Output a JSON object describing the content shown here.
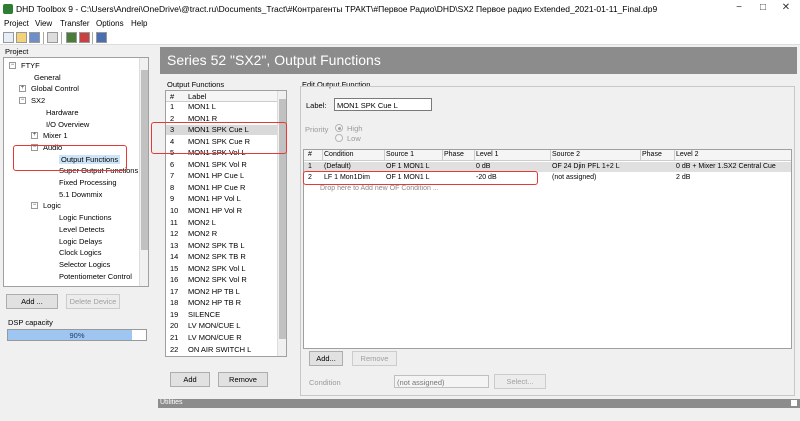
{
  "window": {
    "title": "DHD Toolbox 9 - C:\\Users\\Andrei\\OneDrive\\@tract.ru\\Documents_Tract\\#Контрагенты ТРАКТ\\#Первое Радио\\DHD\\SX2 Первое радио Extended_2021-01-11_Final.dp9"
  },
  "menu": [
    "Project",
    "View",
    "Transfer",
    "Options",
    "Help"
  ],
  "project": {
    "title": "Project",
    "tree": [
      {
        "label": "FTYF",
        "level": 0,
        "exp": "−"
      },
      {
        "label": "General",
        "level": 1
      },
      {
        "label": "Global Control",
        "level": 1,
        "exp": "+"
      },
      {
        "label": "SX2",
        "level": 1,
        "exp": "−"
      },
      {
        "label": "Hardware",
        "level": 2
      },
      {
        "label": "I/O Overview",
        "level": 2
      },
      {
        "label": "Mixer 1",
        "level": 2,
        "exp": "+"
      },
      {
        "label": "Audio",
        "level": 2,
        "exp": "−"
      },
      {
        "label": "Output Functions",
        "level": 3,
        "selected": true
      },
      {
        "label": "Super Output Functions",
        "level": 3
      },
      {
        "label": "Fixed Processing",
        "level": 3
      },
      {
        "label": "5.1 Downmix",
        "level": 3
      },
      {
        "label": "Logic",
        "level": 2,
        "exp": "−"
      },
      {
        "label": "Logic Functions",
        "level": 3
      },
      {
        "label": "Level Detects",
        "level": 3
      },
      {
        "label": "Logic Delays",
        "level": 3
      },
      {
        "label": "Clock Logics",
        "level": 3
      },
      {
        "label": "Selector Logics",
        "level": 3
      },
      {
        "label": "Potentiometer Control",
        "level": 3
      }
    ],
    "add": "Add ...",
    "delete": "Delete Device"
  },
  "dsp": {
    "title": "DSP capacity",
    "value": "90%",
    "fraction": 0.9
  },
  "header": "Series 52 \"SX2\", Output Functions",
  "of_list": {
    "title": "Output Functions",
    "col_num": "#",
    "col_label": "Label",
    "rows": [
      [
        "1",
        "MON1 L"
      ],
      [
        "2",
        "MON1 R"
      ],
      [
        "3",
        "MON1 SPK Cue L"
      ],
      [
        "4",
        "MON1 SPK Cue R"
      ],
      [
        "5",
        "MON1 SPK Vol L"
      ],
      [
        "6",
        "MON1 SPK Vol R"
      ],
      [
        "7",
        "MON1 HP Cue L"
      ],
      [
        "8",
        "MON1 HP Cue R"
      ],
      [
        "9",
        "MON1 HP Vol L"
      ],
      [
        "10",
        "MON1 HP Vol R"
      ],
      [
        "11",
        "MON2 L"
      ],
      [
        "12",
        "MON2 R"
      ],
      [
        "13",
        "MON2 SPK TB L"
      ],
      [
        "14",
        "MON2 SPK TB R"
      ],
      [
        "15",
        "MON2 SPK Vol L"
      ],
      [
        "16",
        "MON2 SPK Vol R"
      ],
      [
        "17",
        "MON2 HP TB L"
      ],
      [
        "18",
        "MON2 HP TB R"
      ],
      [
        "19",
        "SILENCE"
      ],
      [
        "20",
        "LV MON/CUE L"
      ],
      [
        "21",
        "LV MON/CUE R"
      ],
      [
        "22",
        "ON AIR SWITCH L"
      ]
    ],
    "add": "Add",
    "remove": "Remove"
  },
  "edit": {
    "title": "Edit Output Function",
    "label_caption": "Label:",
    "label_value": "MON1 SPK Cue L",
    "priority": "Priority",
    "high": "High",
    "low": "Low",
    "columns": [
      "#",
      "Condition",
      "Source 1",
      "Phase",
      "Level 1",
      "Source 2",
      "Phase",
      "Level 2"
    ],
    "rows": [
      [
        "1",
        "(Default)",
        "OF 1 MON1 L",
        "",
        "0 dB",
        "OF 24 Djin PFL 1+2 L",
        "",
        "0 dB + Mixer 1.SX2 Central Cue"
      ],
      [
        "2",
        "LF 1 Mon1Dim",
        "OF 1 MON1 L",
        "",
        "-20 dB",
        "(not assigned)",
        "",
        "2 dB"
      ]
    ],
    "drop_hint": "Drop here to Add new OF Condition ...",
    "add": "Add...",
    "remove": "Remove",
    "condition": "Condition",
    "condition_value": "(not assigned)",
    "select": "Select..."
  },
  "utilities": "Utilities"
}
